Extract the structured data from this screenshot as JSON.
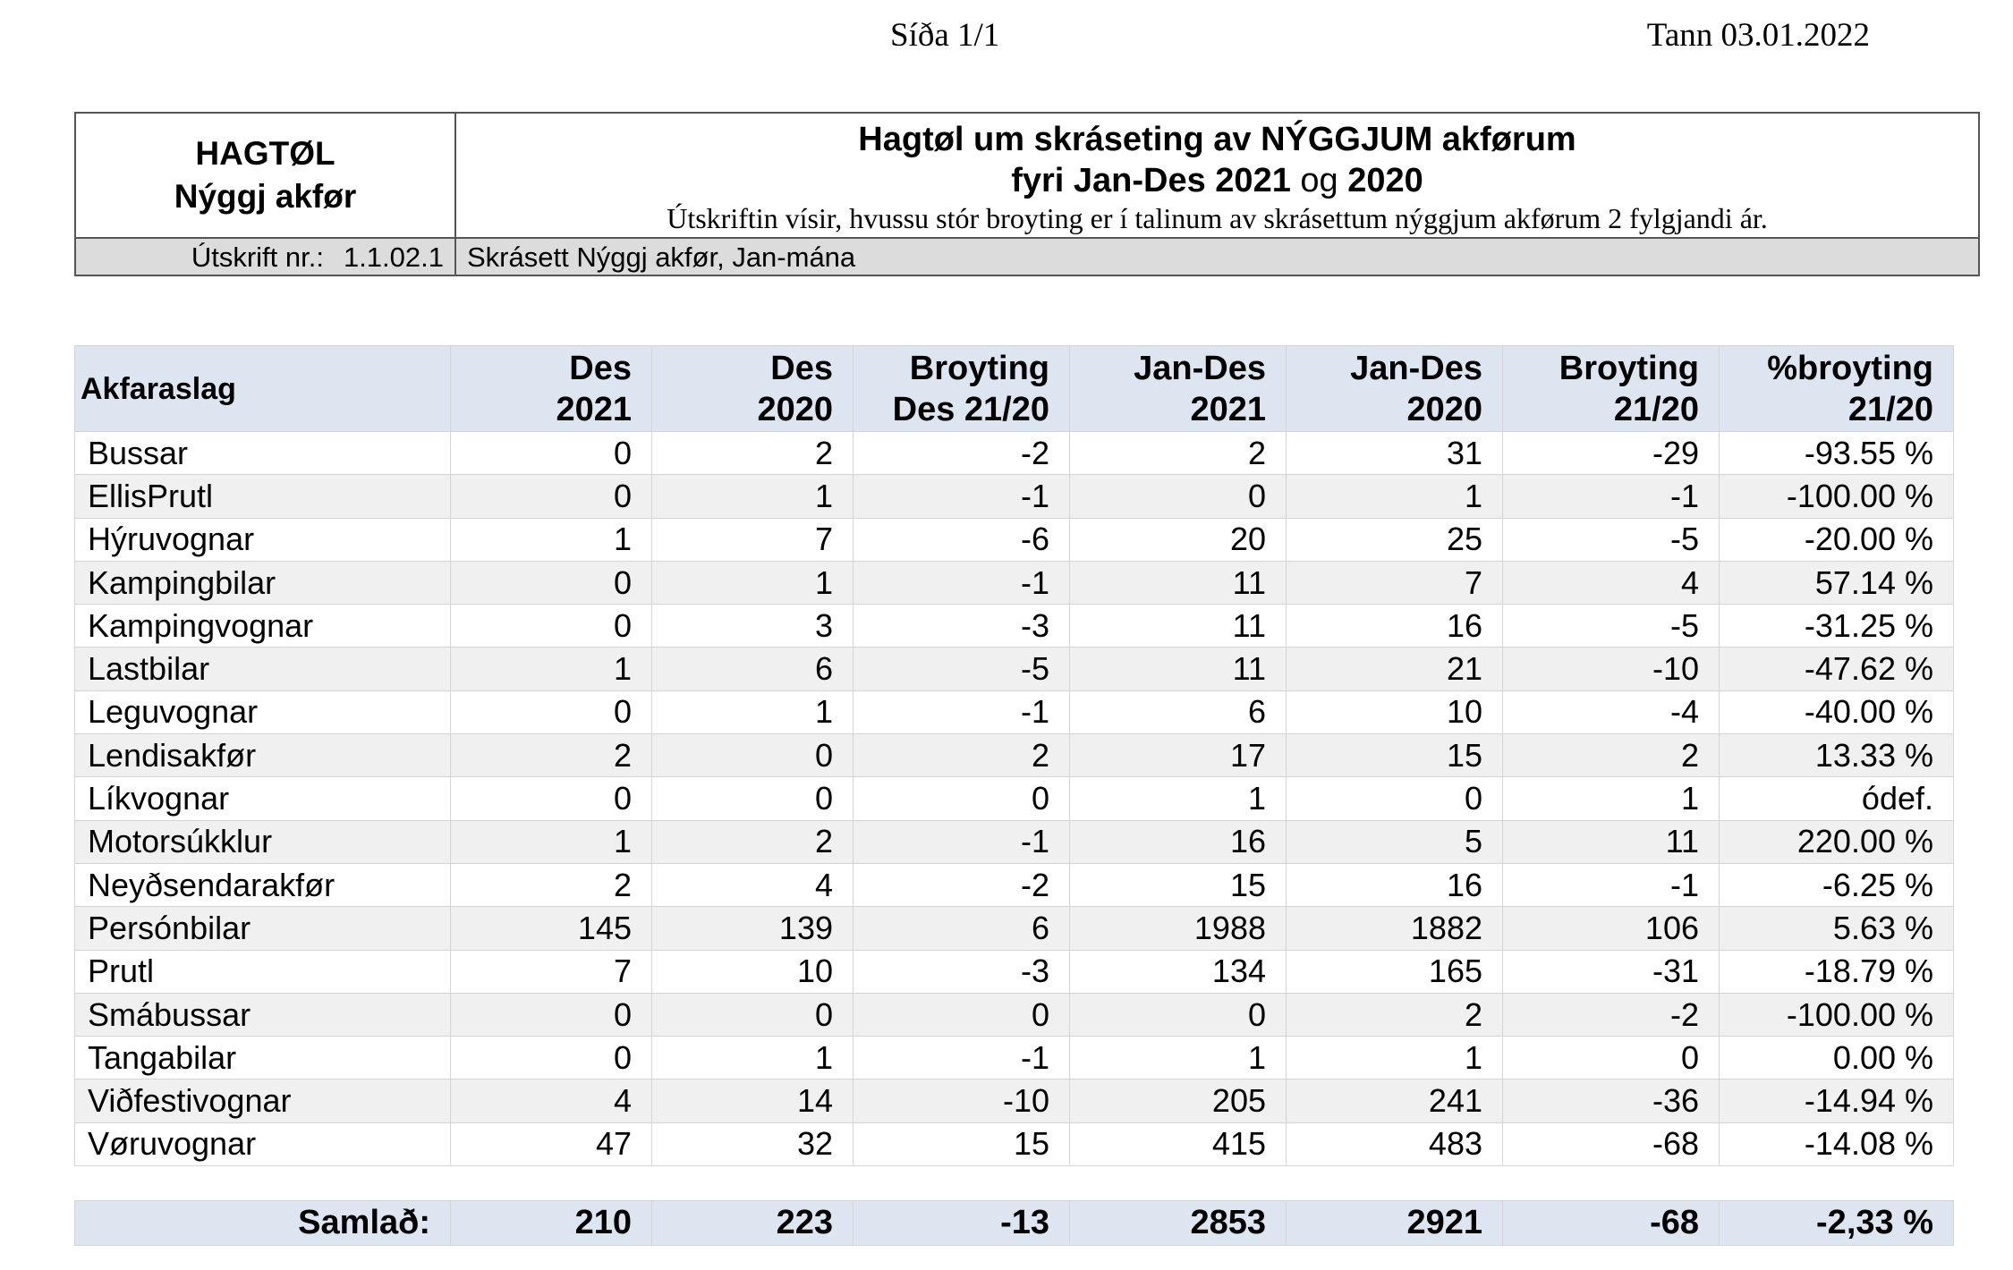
{
  "page_label": "Síða 1/1",
  "print_date": "Tann 03.01.2022",
  "header": {
    "left_line1": "HAGTØL",
    "left_line2": "Nýggj akfør",
    "title_line1": "Hagtøl um skráseting av NÝGGJUM akførum",
    "title_line2_a": "fyri Jan-Des 2021",
    "title_line2_og": "og",
    "title_line2_b": "2020",
    "description": "Útskriftin vísir, hvussu stór broyting er í talinum av skrásettum nýggjum akførum 2 fylgjandi ár.",
    "printout_label": "Útskrift nr.:",
    "printout_number": "1.1.02.1",
    "printout_title": "Skrásett Nýggj akfør, Jan-mána"
  },
  "table": {
    "columns": [
      {
        "l1": "Akfaraslag",
        "l2": ""
      },
      {
        "l1": "Des",
        "l2": "2021"
      },
      {
        "l1": "Des",
        "l2": "2020"
      },
      {
        "l1": "Broyting",
        "l2": "Des 21/20"
      },
      {
        "l1": "Jan-Des",
        "l2": "2021"
      },
      {
        "l1": "Jan-Des",
        "l2": "2020"
      },
      {
        "l1": "Broyting",
        "l2": "21/20"
      },
      {
        "l1": "%broyting",
        "l2": "21/20"
      }
    ],
    "rows": [
      [
        "Bussar",
        "0",
        "2",
        "-2",
        "2",
        "31",
        "-29",
        "-93.55 %"
      ],
      [
        "EllisPrutl",
        "0",
        "1",
        "-1",
        "0",
        "1",
        "-1",
        "-100.00 %"
      ],
      [
        "Hýruvognar",
        "1",
        "7",
        "-6",
        "20",
        "25",
        "-5",
        "-20.00 %"
      ],
      [
        "Kampingbilar",
        "0",
        "1",
        "-1",
        "11",
        "7",
        "4",
        "57.14 %"
      ],
      [
        "Kampingvognar",
        "0",
        "3",
        "-3",
        "11",
        "16",
        "-5",
        "-31.25 %"
      ],
      [
        "Lastbilar",
        "1",
        "6",
        "-5",
        "11",
        "21",
        "-10",
        "-47.62 %"
      ],
      [
        "Leguvognar",
        "0",
        "1",
        "-1",
        "6",
        "10",
        "-4",
        "-40.00 %"
      ],
      [
        "Lendisakfør",
        "2",
        "0",
        "2",
        "17",
        "15",
        "2",
        "13.33 %"
      ],
      [
        "Líkvognar",
        "0",
        "0",
        "0",
        "1",
        "0",
        "1",
        "ódef."
      ],
      [
        "Motorsúkklur",
        "1",
        "2",
        "-1",
        "16",
        "5",
        "11",
        "220.00 %"
      ],
      [
        "Neyðsendarakfør",
        "2",
        "4",
        "-2",
        "15",
        "16",
        "-1",
        "-6.25 %"
      ],
      [
        "Persónbilar",
        "145",
        "139",
        "6",
        "1988",
        "1882",
        "106",
        "5.63 %"
      ],
      [
        "Prutl",
        "7",
        "10",
        "-3",
        "134",
        "165",
        "-31",
        "-18.79 %"
      ],
      [
        "Smábussar",
        "0",
        "0",
        "0",
        "0",
        "2",
        "-2",
        "-100.00 %"
      ],
      [
        "Tangabilar",
        "0",
        "1",
        "-1",
        "1",
        "1",
        "0",
        "0.00 %"
      ],
      [
        "Viðfestivognar",
        "4",
        "14",
        "-10",
        "205",
        "241",
        "-36",
        "-14.94 %"
      ],
      [
        "Vøruvognar",
        "47",
        "32",
        "15",
        "415",
        "483",
        "-68",
        "-14.08 %"
      ]
    ],
    "total": [
      "Samlað:",
      "210",
      "223",
      "-13",
      "2853",
      "2921",
      "-68",
      "-2,33 %"
    ]
  }
}
